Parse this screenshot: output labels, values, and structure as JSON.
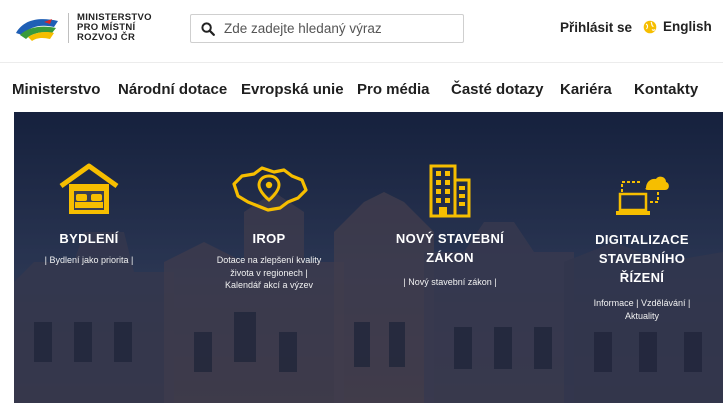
{
  "header": {
    "logo": {
      "line1": "MINISTERSTVO",
      "line2": "PRO MÍSTNÍ",
      "line3": "ROZVOJ ČR"
    },
    "search": {
      "placeholder": "Zde zadejte hledaný výraz",
      "icon": "search-icon"
    },
    "login_label": "Přihlásit se",
    "language": {
      "label": "English",
      "icon": "globe-icon"
    }
  },
  "nav": {
    "items": [
      {
        "label": "Ministerstvo"
      },
      {
        "label": "Národní dotace"
      },
      {
        "label": "Evropská unie"
      },
      {
        "label": "Pro média"
      },
      {
        "label": "Časté dotazy"
      },
      {
        "label": "Kariéra"
      },
      {
        "label": "Kontakty"
      }
    ]
  },
  "hero": {
    "accent_color": "#f6be00",
    "tiles": [
      {
        "icon": "house-bed-icon",
        "title_lines": [
          "BYDLENÍ"
        ],
        "link_lines": [
          "| Bydlení jako priorita |"
        ]
      },
      {
        "icon": "czech-map-pin-icon",
        "title_lines": [
          "IROP"
        ],
        "link_lines": [
          "Dotace na zlepšení kvality",
          "života v regionech |",
          "Kalendář akcí a výzev"
        ]
      },
      {
        "icon": "building-icon",
        "title_lines": [
          "NOVÝ STAVEBNÍ",
          "ZÁKON"
        ],
        "link_lines": [
          "| Nový stavební zákon |"
        ]
      },
      {
        "icon": "laptop-cloud-icon",
        "title_lines": [
          "DIGITALIZACE",
          "STAVEBNÍHO",
          "ŘÍZENÍ"
        ],
        "link_lines": [
          "Informace | Vzdělávání |",
          "Aktuality"
        ]
      }
    ]
  }
}
